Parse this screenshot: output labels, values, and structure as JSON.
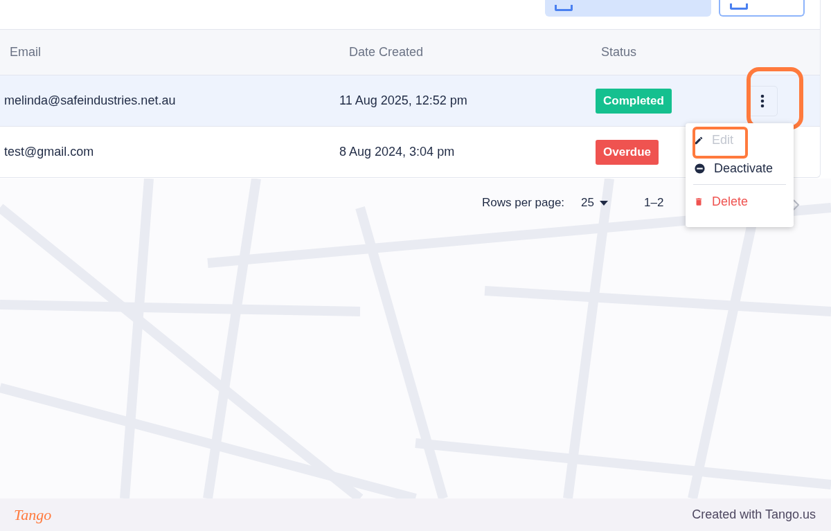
{
  "toolbar_buttons": [
    {
      "kind": "filled"
    },
    {
      "kind": "outlined"
    }
  ],
  "table": {
    "columns": [
      "Email",
      "Date Created",
      "Status"
    ],
    "rows": [
      {
        "email": "melinda@safeindustries.net.au",
        "date": "11 Aug 2025, 12:52 pm",
        "status": "Completed",
        "color": "#15c08f",
        "selected": true,
        "highlighted": true
      },
      {
        "email": "test@gmail.com",
        "date": "8 Aug 2024, 3:04 pm",
        "status": "Overdue",
        "color": "#ef5350",
        "selected": false,
        "highlighted": false
      }
    ]
  },
  "pagination": {
    "rows_label": "Rows per page:",
    "rows_value": "25",
    "range": "1–2"
  },
  "menu": {
    "items": [
      {
        "kind": "edit",
        "label": "Edit",
        "disabled": true,
        "highlighted": true
      },
      {
        "kind": "deactivate",
        "label": "Deactivate",
        "disabled": false,
        "highlighted": false
      },
      {
        "kind": "delete",
        "label": "Delete",
        "disabled": false,
        "highlighted": false
      }
    ]
  },
  "footer": {
    "logo": "Tango",
    "credit": "Created with Tango.us"
  }
}
